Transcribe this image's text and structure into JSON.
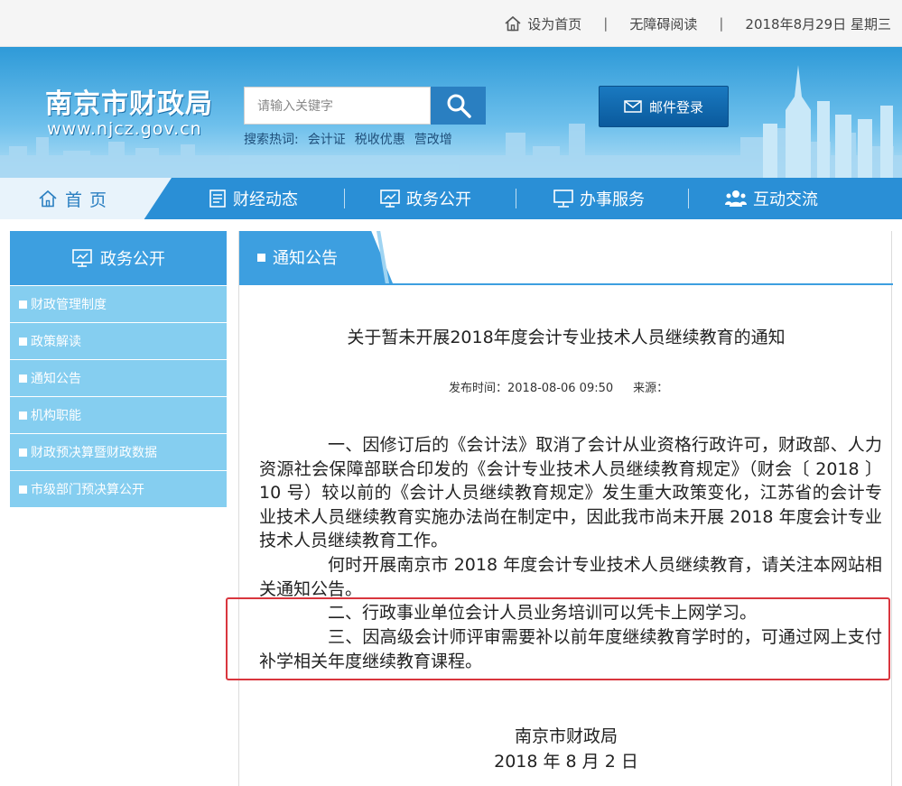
{
  "topbar": {
    "set_home": "设为首页",
    "accessible": "无障碍阅读",
    "date": "2018年8月29日 星期三",
    "separator": "|"
  },
  "banner": {
    "logo_cn": "南京市财政局",
    "logo_en": "www.njcz.gov.cn",
    "search_placeholder": "请输入关键字",
    "hot_label": "搜索热词:",
    "hot_words": [
      "会计证",
      "税收优惠",
      "营改增"
    ],
    "mail_login": "邮件登录"
  },
  "nav": {
    "home": "首页",
    "items": [
      "财经动态",
      "政务公开",
      "办事服务",
      "互动交流"
    ]
  },
  "sidebar": {
    "title": "政务公开",
    "items": [
      "财政管理制度",
      "政策解读",
      "通知公告",
      "机构职能",
      "财政预决算暨财政数据",
      "市级部门预决算公开"
    ]
  },
  "content": {
    "tab": "通知公告",
    "title": "关于暂未开展2018年度会计专业技术人员继续教育的通知",
    "publish_time": "发布时间：2018-08-06 09:50",
    "source": "来源：",
    "para1": "一、因修订后的《会计法》取消了会计从业资格行政许可，财政部、人力资源社会保障部联合印发的《会计专业技术人员继续教育规定》（财会〔 2018 〕 10 号）较以前的《会计人员继续教育规定》发生重大政策变化，江苏省的会计专业技术人员继续教育实施办法尚在制定中，因此我市尚未开展 2018 年度会计专业技术人员继续教育工作。",
    "para2": "何时开展南京市 2018 年度会计专业技术人员继续教育，请关注本网站相关通知公告。",
    "para3": "二、行政事业单位会计人员业务培训可以凭卡上网学习。",
    "para4": "三、因高级会计师评审需要补以前年度继续教育学时的，可通过网上支付补学相关年度继续教育课程。",
    "sign_org": "南京市财政局",
    "sign_date": "2018 年 8 月 2 日"
  },
  "colors": {
    "nav_blue": "#2a8fd6",
    "sidebar_item": "#85cef0",
    "highlight_red": "#d9363e"
  }
}
